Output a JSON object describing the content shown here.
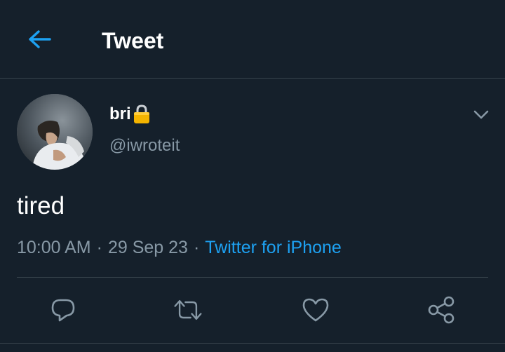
{
  "header": {
    "title": "Tweet",
    "back_icon": "arrow-left-icon"
  },
  "tweet": {
    "author": {
      "display_name": "bri",
      "handle": "@iwroteit",
      "protected_icon": "lock-icon"
    },
    "text": "tired",
    "time": "10:00 AM",
    "date": "29 Sep 23",
    "source": "Twitter for iPhone",
    "separator": "·"
  },
  "actions": [
    {
      "name": "reply",
      "icon": "reply-icon"
    },
    {
      "name": "retweet",
      "icon": "retweet-icon"
    },
    {
      "name": "like",
      "icon": "heart-icon"
    },
    {
      "name": "share",
      "icon": "share-icon"
    }
  ],
  "colors": {
    "background": "#15202b",
    "accent": "#1da1f2",
    "secondary_text": "#8899a6",
    "divider": "#38444d",
    "lock": "#f4b400"
  }
}
